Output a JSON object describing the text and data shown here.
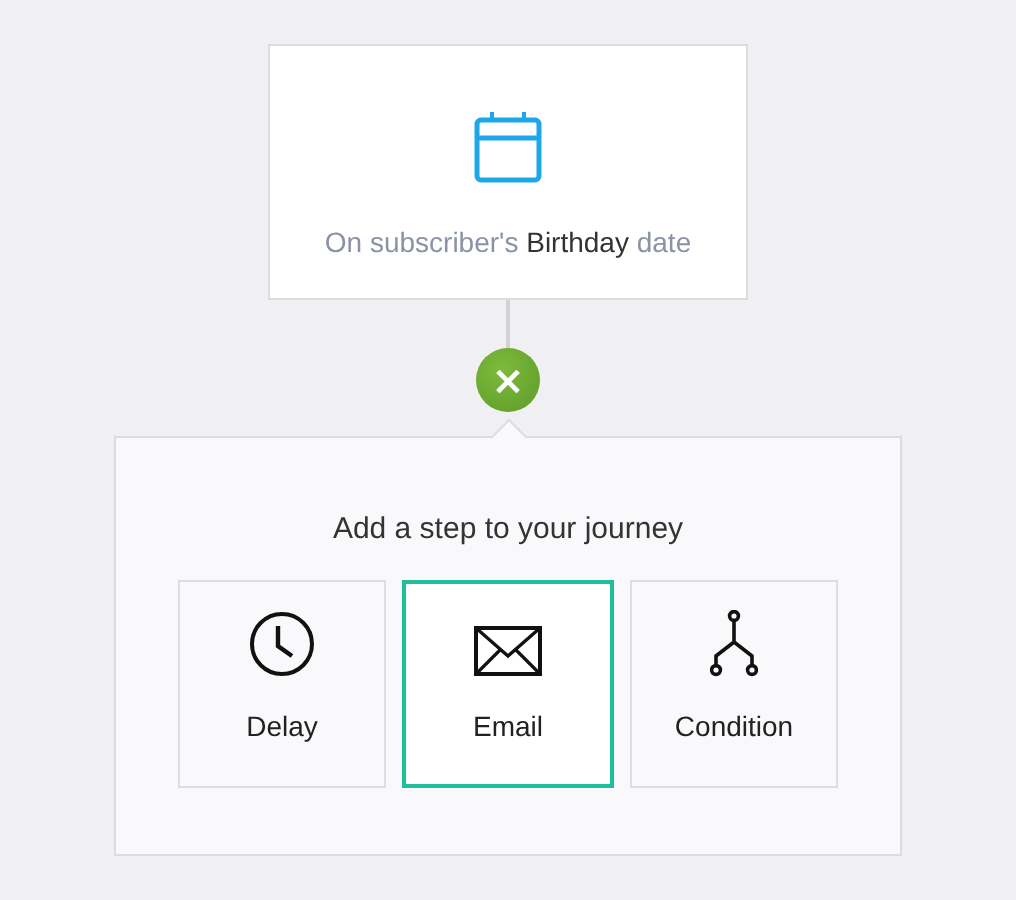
{
  "trigger": {
    "text": "On subscriber's **Birthday** date"
  },
  "add_step": {
    "close_label": "×",
    "title": "Add a step to your journey",
    "options": [
      {
        "kind": "delay",
        "label": "Delay",
        "selected": false
      },
      {
        "kind": "email",
        "label": "Email",
        "selected": true
      },
      {
        "kind": "condition",
        "label": "Condition",
        "selected": false
      }
    ]
  }
}
